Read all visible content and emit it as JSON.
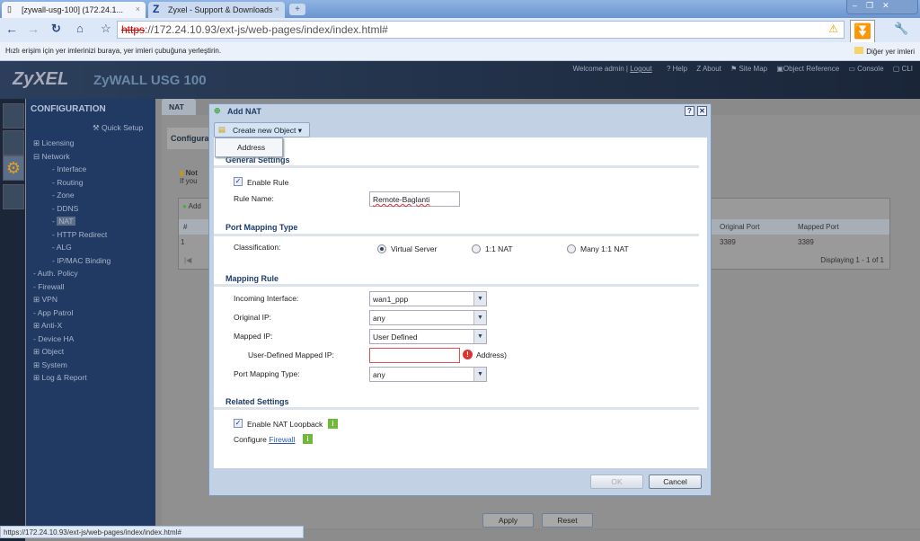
{
  "browser": {
    "tabs": [
      {
        "label": "[zywall-usg-100] (172.24.1..."
      },
      {
        "label": "Zyxel - Support & Downloads"
      }
    ],
    "url_scheme": "https",
    "url_rest": "://172.24.10.93/ext-js/web-pages/index/index.html#",
    "bookmarks_hint": "Hızlı erişim için yer imlerinizi buraya, yer imleri çubuğuna yerleştirin.",
    "other_bookmarks": "Diğer yer imleri",
    "status_url": "https://172.24.10.93/ext-js/web-pages/index/index.html#"
  },
  "header": {
    "logo": "ZyXEL",
    "model": "ZyWALL USG 100",
    "welcome": "Welcome admin",
    "logout": "Logout",
    "links": [
      "Help",
      "About",
      "Site Map",
      "Object Reference",
      "Console",
      "CLI"
    ]
  },
  "sidebar": {
    "title": "CONFIGURATION",
    "quick_setup": "Quick Setup",
    "items": [
      {
        "label": "Licensing",
        "prefix": "⊞",
        "level": 0
      },
      {
        "label": "Network",
        "prefix": "⊟",
        "level": 0
      },
      {
        "label": "Interface",
        "prefix": "-",
        "level": 1
      },
      {
        "label": "Routing",
        "prefix": "-",
        "level": 1
      },
      {
        "label": "Zone",
        "prefix": "-",
        "level": 1
      },
      {
        "label": "DDNS",
        "prefix": "-",
        "level": 1
      },
      {
        "label": "NAT",
        "prefix": "-",
        "level": 1,
        "selected": true
      },
      {
        "label": "HTTP Redirect",
        "prefix": "-",
        "level": 1
      },
      {
        "label": "ALG",
        "prefix": "-",
        "level": 1
      },
      {
        "label": "IP/MAC Binding",
        "prefix": "-",
        "level": 1
      },
      {
        "label": "Auth. Policy",
        "prefix": "-",
        "level": 0
      },
      {
        "label": "Firewall",
        "prefix": "-",
        "level": 0
      },
      {
        "label": "VPN",
        "prefix": "⊞",
        "level": 0
      },
      {
        "label": "App Patrol",
        "prefix": "-",
        "level": 0
      },
      {
        "label": "Anti-X",
        "prefix": "⊞",
        "level": 0
      },
      {
        "label": "Device HA",
        "prefix": "-",
        "level": 0
      },
      {
        "label": "Object",
        "prefix": "⊞",
        "level": 0
      },
      {
        "label": "System",
        "prefix": "⊞",
        "level": 0
      },
      {
        "label": "Log & Report",
        "prefix": "⊞",
        "level": 0
      }
    ]
  },
  "main": {
    "tab": "NAT",
    "panel_title": "Configura",
    "note": "Not",
    "note2": "If you",
    "add": "Add",
    "table": {
      "headers": [
        "#",
        "Original Port",
        "Mapped Port"
      ],
      "row": [
        "1",
        "3389",
        "3389"
      ]
    },
    "paging": "Displaying 1 - 1 of 1",
    "apply": "Apply",
    "reset": "Reset"
  },
  "dialog": {
    "title": "Add NAT",
    "create_object": "Create new Object",
    "menu_item": "Address",
    "general": "General Settings",
    "enable_rule": "Enable Rule",
    "rule_name_label": "Rule Name:",
    "rule_name": "Remote-Baglanti",
    "port_mapping_type": "Port Mapping Type",
    "classification": "Classification:",
    "radios": [
      "Virtual Server",
      "1:1 NAT",
      "Many 1:1 NAT"
    ],
    "mapping_rule": "Mapping Rule",
    "incoming_label": "Incoming Interface:",
    "incoming": "wan1_ppp",
    "orig_ip_label": "Original IP:",
    "orig_ip": "any",
    "mapped_ip_label": "Mapped IP:",
    "mapped_ip": "User Defined",
    "user_mapped_label": "User-Defined Mapped IP:",
    "user_mapped": "",
    "address_hint": "Address)",
    "pmt_label": "Port Mapping Type:",
    "pmt": "any",
    "related": "Related Settings",
    "nat_loopback": "Enable NAT Loopback",
    "configure": "Configure",
    "firewall": "Firewall",
    "ok": "OK",
    "cancel": "Cancel"
  }
}
